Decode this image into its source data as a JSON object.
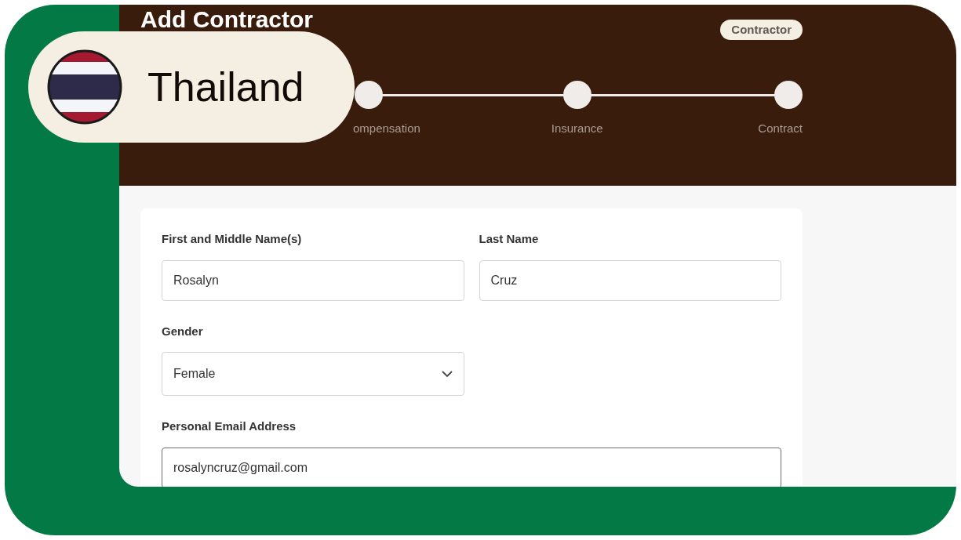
{
  "country_pill": {
    "label": "Thailand"
  },
  "header": {
    "title": "Add Contractor",
    "tag": "Contractor",
    "steps": [
      {
        "label": "ompensation"
      },
      {
        "label": "Insurance"
      },
      {
        "label": "Contract"
      }
    ]
  },
  "form": {
    "fields": [
      {
        "kind": "text",
        "label": "First and Middle Name(s)",
        "value": "Rosalyn",
        "focused": false
      },
      {
        "kind": "text",
        "label": "Last Name",
        "value": "Cruz",
        "focused": false
      },
      {
        "kind": "select",
        "label": "Gender",
        "value": "Female",
        "focused": false
      },
      {
        "kind": "email",
        "label": "Personal Email Address",
        "value": "rosalyncruz@gmail.com",
        "focused": true
      }
    ]
  }
}
